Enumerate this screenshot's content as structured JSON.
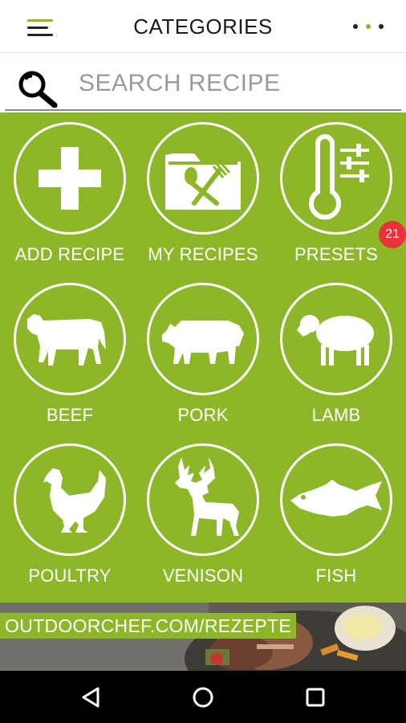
{
  "header": {
    "title": "CATEGORIES",
    "menu_icon": "hamburger-menu-icon",
    "more_icon": "more-dots-icon"
  },
  "search": {
    "placeholder": "SEARCH RECIPE",
    "value": "",
    "icon": "magnifier-icon"
  },
  "categories": [
    {
      "label": "ADD RECIPE",
      "icon": "plus-icon"
    },
    {
      "label": "MY RECIPES",
      "icon": "folder-cutlery-icon"
    },
    {
      "label": "PRESETS",
      "icon": "thermometer-sliders-icon",
      "badge": "21"
    },
    {
      "label": "BEEF",
      "icon": "cow-icon"
    },
    {
      "label": "PORK",
      "icon": "pig-icon"
    },
    {
      "label": "LAMB",
      "icon": "sheep-icon"
    },
    {
      "label": "POULTRY",
      "icon": "chicken-icon"
    },
    {
      "label": "VENISON",
      "icon": "deer-icon"
    },
    {
      "label": "FISH",
      "icon": "fish-icon"
    }
  ],
  "banner": {
    "text": "OUTDOORCHEF.COM/REZEPTE"
  },
  "navbar": {
    "back_icon": "back-triangle-icon",
    "home_icon": "home-circle-icon",
    "recents_icon": "recents-square-icon"
  },
  "colors": {
    "accent_green": "#8db628",
    "badge_red": "#e8333b",
    "text_dark": "#1a1a1a"
  }
}
